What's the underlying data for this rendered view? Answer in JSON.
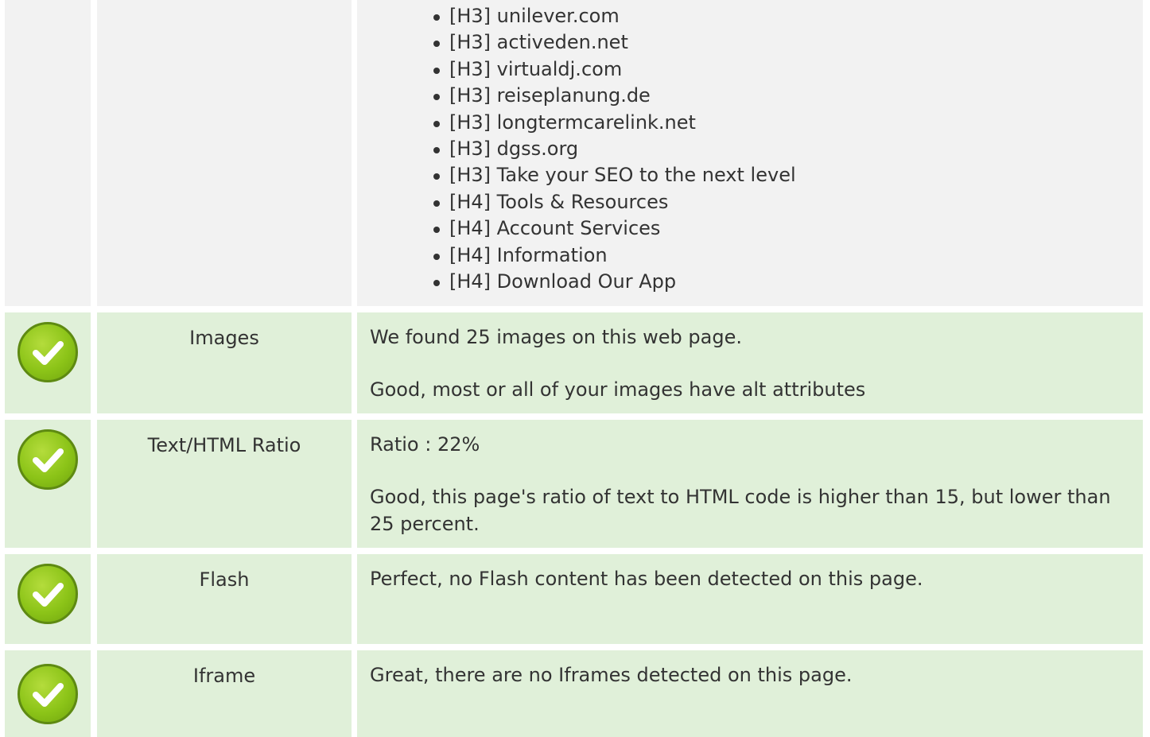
{
  "headings_list": [
    "[H3] unilever.com",
    "[H3] activeden.net",
    "[H3] virtualdj.com",
    "[H3] reiseplanung.de",
    "[H3] longtermcarelink.net",
    "[H3] dgss.org",
    "[H3] Take your SEO to the next level",
    "[H4] Tools & Resources",
    "[H4] Account Services",
    "[H4] Information",
    "[H4] Download Our App"
  ],
  "rows": {
    "images": {
      "status_icon": "check-icon",
      "label": "Images",
      "line1": "We found 25 images on this web page.",
      "line2": "Good, most or all of your images have alt attributes"
    },
    "text_html_ratio": {
      "status_icon": "check-icon",
      "label": "Text/HTML Ratio",
      "line1": "Ratio : 22%",
      "line2": "Good, this page's ratio of text to HTML code is higher than 15, but lower than 25 percent."
    },
    "flash": {
      "status_icon": "check-icon",
      "label": "Flash",
      "line1": "Perfect, no Flash content has been detected on this page."
    },
    "iframe": {
      "status_icon": "check-icon",
      "label": "Iframe",
      "line1": "Great, there are no Iframes detected on this page."
    }
  },
  "colors": {
    "good_row_bg": "#e0f0d9",
    "plain_row_bg": "#f2f2f2",
    "check_green": "#8cc418",
    "text": "#333333"
  }
}
